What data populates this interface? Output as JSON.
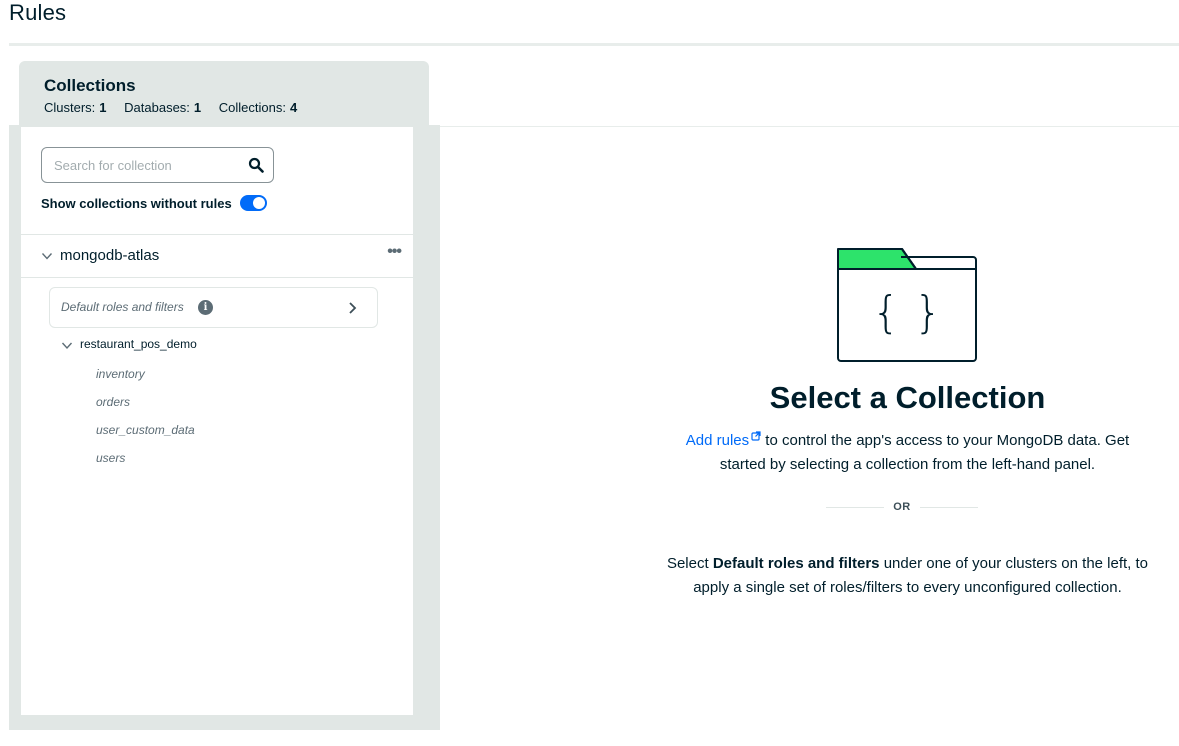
{
  "page": {
    "title": "Rules"
  },
  "sidebar": {
    "tab_title": "Collections",
    "stats": {
      "clusters_label": "Clusters:",
      "clusters_value": "1",
      "databases_label": "Databases:",
      "databases_value": "1",
      "collections_label": "Collections:",
      "collections_value": "4"
    },
    "search": {
      "placeholder": "Search for collection",
      "value": ""
    },
    "toggle": {
      "label": "Show collections without rules",
      "on": true
    },
    "cluster": {
      "name": "mongodb-atlas",
      "more": "•••"
    },
    "default_card": {
      "label": "Default roles and filters",
      "info": "i"
    },
    "database": {
      "name": "restaurant_pos_demo",
      "collections": [
        "inventory",
        "orders",
        "user_custom_data",
        "users"
      ]
    }
  },
  "empty_state": {
    "title": "Select a Collection",
    "link_text": "Add rules",
    "desc_line_1_rest": " to control the app's access to your MongoDB data. Get",
    "desc_line_2": "started by selecting a collection from the left-hand panel.",
    "or_text": "OR",
    "desc2_prefix": "Select ",
    "desc2_bold": "Default roles and filters",
    "desc2_line_1_rest": " under one of your clusters on the left, to",
    "desc2_line_2": "apply a single set of roles/filters to every unconfigured collection."
  },
  "colors": {
    "accent": "#016bf8",
    "folder_tab": "#2de36b",
    "panel_bg": "#e1e7e5",
    "text": "#001e2b"
  },
  "icons": {
    "search": "search-icon",
    "cluster_chevron": "chevron-down-icon",
    "more": "ellipsis-icon",
    "info": "info-icon",
    "card_chevron": "chevron-right-icon",
    "external": "external-link-icon",
    "illustration": "folder-braces-icon"
  }
}
